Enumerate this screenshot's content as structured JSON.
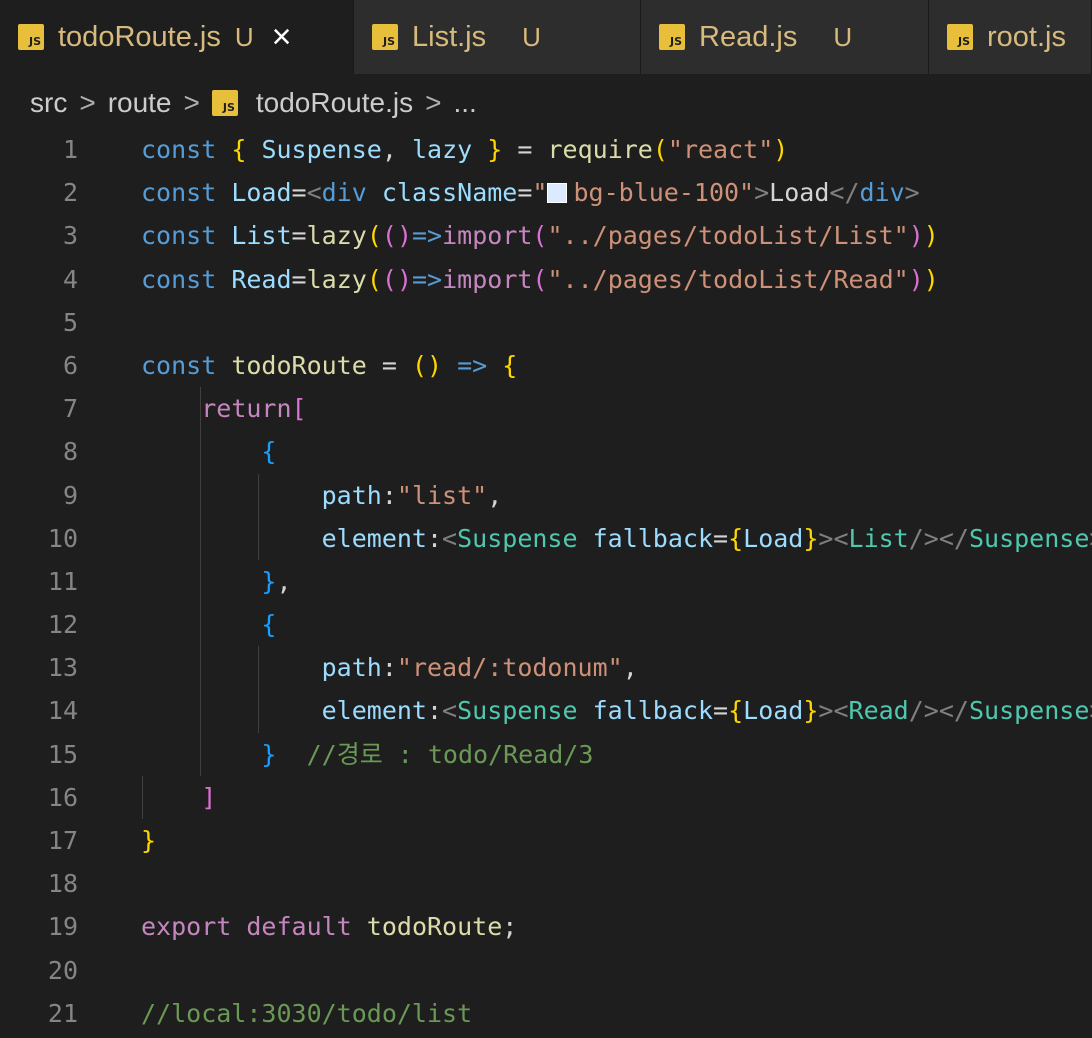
{
  "tabs": [
    {
      "label": "todoRoute.js",
      "status": "U",
      "active": true,
      "icon": "js-file-icon"
    },
    {
      "label": "List.js",
      "status": "U",
      "active": false,
      "icon": "js-file-icon"
    },
    {
      "label": "Read.js",
      "status": "U",
      "active": false,
      "icon": "js-file-icon"
    },
    {
      "label": "root.js",
      "status": "",
      "active": false,
      "icon": "js-file-icon"
    }
  ],
  "tab_icon_text": "JS",
  "tab_close_glyph": "×",
  "breadcrumb": {
    "items": [
      "src",
      "route",
      "todoRoute.js",
      "..."
    ],
    "separator": ">"
  },
  "editor": {
    "line_numbers": [
      "1",
      "2",
      "3",
      "4",
      "5",
      "6",
      "7",
      "8",
      "9",
      "10",
      "11",
      "12",
      "13",
      "14",
      "15",
      "16",
      "17",
      "18",
      "19",
      "20",
      "21"
    ],
    "lines": [
      [
        {
          "c": "kw",
          "t": "const"
        },
        {
          "c": "txt",
          "t": " "
        },
        {
          "c": "br1",
          "t": "{"
        },
        {
          "c": "txt",
          "t": " "
        },
        {
          "c": "var",
          "t": "Suspense"
        },
        {
          "c": "txt",
          "t": ", "
        },
        {
          "c": "var",
          "t": "lazy"
        },
        {
          "c": "txt",
          "t": " "
        },
        {
          "c": "br1",
          "t": "}"
        },
        {
          "c": "txt",
          "t": " = "
        },
        {
          "c": "fn",
          "t": "require"
        },
        {
          "c": "br1",
          "t": "("
        },
        {
          "c": "str",
          "t": "\"react\""
        },
        {
          "c": "br1",
          "t": ")"
        }
      ],
      [
        {
          "c": "kw",
          "t": "const"
        },
        {
          "c": "txt",
          "t": " "
        },
        {
          "c": "var",
          "t": "Load"
        },
        {
          "c": "txt",
          "t": "="
        },
        {
          "c": "punct",
          "t": "<"
        },
        {
          "c": "html-tag",
          "t": "div"
        },
        {
          "c": "txt",
          "t": " "
        },
        {
          "c": "var",
          "t": "className"
        },
        {
          "c": "txt",
          "t": "="
        },
        {
          "c": "str",
          "t": "\""
        },
        {
          "c": "swatch",
          "t": ""
        },
        {
          "c": "str",
          "t": "bg-blue-100\""
        },
        {
          "c": "punct",
          "t": ">"
        },
        {
          "c": "txt",
          "t": "Load"
        },
        {
          "c": "punct",
          "t": "</"
        },
        {
          "c": "html-tag",
          "t": "div"
        },
        {
          "c": "punct",
          "t": ">"
        }
      ],
      [
        {
          "c": "kw",
          "t": "const"
        },
        {
          "c": "txt",
          "t": " "
        },
        {
          "c": "var",
          "t": "List"
        },
        {
          "c": "txt",
          "t": "="
        },
        {
          "c": "fn",
          "t": "lazy"
        },
        {
          "c": "br1",
          "t": "("
        },
        {
          "c": "br2",
          "t": "()"
        },
        {
          "c": "kw",
          "t": "=>"
        },
        {
          "c": "kw2",
          "t": "import"
        },
        {
          "c": "br2",
          "t": "("
        },
        {
          "c": "str",
          "t": "\"../pages/todoList/List\""
        },
        {
          "c": "br2",
          "t": ")"
        },
        {
          "c": "br1",
          "t": ")"
        }
      ],
      [
        {
          "c": "kw",
          "t": "const"
        },
        {
          "c": "txt",
          "t": " "
        },
        {
          "c": "var",
          "t": "Read"
        },
        {
          "c": "txt",
          "t": "="
        },
        {
          "c": "fn",
          "t": "lazy"
        },
        {
          "c": "br1",
          "t": "("
        },
        {
          "c": "br2",
          "t": "()"
        },
        {
          "c": "kw",
          "t": "=>"
        },
        {
          "c": "kw2",
          "t": "import"
        },
        {
          "c": "br2",
          "t": "("
        },
        {
          "c": "str",
          "t": "\"../pages/todoList/Read\""
        },
        {
          "c": "br2",
          "t": ")"
        },
        {
          "c": "br1",
          "t": ")"
        }
      ],
      [],
      [
        {
          "c": "kw",
          "t": "const"
        },
        {
          "c": "txt",
          "t": " "
        },
        {
          "c": "fn",
          "t": "todoRoute"
        },
        {
          "c": "txt",
          "t": " = "
        },
        {
          "c": "br1",
          "t": "()"
        },
        {
          "c": "txt",
          "t": " "
        },
        {
          "c": "kw",
          "t": "=>"
        },
        {
          "c": "txt",
          "t": " "
        },
        {
          "c": "br1",
          "t": "{"
        }
      ],
      [
        {
          "c": "txt",
          "t": "    "
        },
        {
          "c": "kw2",
          "t": "return"
        },
        {
          "c": "br2",
          "t": "["
        }
      ],
      [
        {
          "c": "txt",
          "t": "        "
        },
        {
          "c": "br3",
          "t": "{"
        }
      ],
      [
        {
          "c": "txt",
          "t": "            "
        },
        {
          "c": "var",
          "t": "path"
        },
        {
          "c": "txt",
          "t": ":"
        },
        {
          "c": "str",
          "t": "\"list\""
        },
        {
          "c": "txt",
          "t": ","
        }
      ],
      [
        {
          "c": "txt",
          "t": "            "
        },
        {
          "c": "var",
          "t": "element"
        },
        {
          "c": "txt",
          "t": ":"
        },
        {
          "c": "punct",
          "t": "<"
        },
        {
          "c": "tag",
          "t": "Suspense"
        },
        {
          "c": "txt",
          "t": " "
        },
        {
          "c": "var",
          "t": "fallback"
        },
        {
          "c": "txt",
          "t": "="
        },
        {
          "c": "br1",
          "t": "{"
        },
        {
          "c": "var",
          "t": "Load"
        },
        {
          "c": "br1",
          "t": "}"
        },
        {
          "c": "punct",
          "t": "><"
        },
        {
          "c": "tag",
          "t": "List"
        },
        {
          "c": "punct",
          "t": "/></"
        },
        {
          "c": "tag",
          "t": "Suspense"
        },
        {
          "c": "punct",
          "t": ">"
        }
      ],
      [
        {
          "c": "txt",
          "t": "        "
        },
        {
          "c": "br3",
          "t": "}"
        },
        {
          "c": "txt",
          "t": ","
        }
      ],
      [
        {
          "c": "txt",
          "t": "        "
        },
        {
          "c": "br3",
          "t": "{"
        }
      ],
      [
        {
          "c": "txt",
          "t": "            "
        },
        {
          "c": "var",
          "t": "path"
        },
        {
          "c": "txt",
          "t": ":"
        },
        {
          "c": "str",
          "t": "\"read/:todonum\""
        },
        {
          "c": "txt",
          "t": ","
        }
      ],
      [
        {
          "c": "txt",
          "t": "            "
        },
        {
          "c": "var",
          "t": "element"
        },
        {
          "c": "txt",
          "t": ":"
        },
        {
          "c": "punct",
          "t": "<"
        },
        {
          "c": "tag",
          "t": "Suspense"
        },
        {
          "c": "txt",
          "t": " "
        },
        {
          "c": "var",
          "t": "fallback"
        },
        {
          "c": "txt",
          "t": "="
        },
        {
          "c": "br1",
          "t": "{"
        },
        {
          "c": "var",
          "t": "Load"
        },
        {
          "c": "br1",
          "t": "}"
        },
        {
          "c": "punct",
          "t": "><"
        },
        {
          "c": "tag",
          "t": "Read"
        },
        {
          "c": "punct",
          "t": "/></"
        },
        {
          "c": "tag",
          "t": "Suspense"
        },
        {
          "c": "punct",
          "t": ">"
        }
      ],
      [
        {
          "c": "txt",
          "t": "        "
        },
        {
          "c": "br3",
          "t": "}"
        },
        {
          "c": "txt",
          "t": "  "
        },
        {
          "c": "cm",
          "t": "//경로 : todo/Read/3"
        }
      ],
      [
        {
          "c": "txt",
          "t": "    "
        },
        {
          "c": "br2",
          "t": "]"
        }
      ],
      [
        {
          "c": "br1",
          "t": "}"
        }
      ],
      [],
      [
        {
          "c": "kw2",
          "t": "export"
        },
        {
          "c": "txt",
          "t": " "
        },
        {
          "c": "kw2",
          "t": "default"
        },
        {
          "c": "txt",
          "t": " "
        },
        {
          "c": "fn",
          "t": "todoRoute"
        },
        {
          "c": "txt",
          "t": ";"
        }
      ],
      [],
      [
        {
          "c": "cm",
          "t": "//local:3030/todo/list"
        }
      ]
    ]
  },
  "colors": {
    "background": "#1e1e1e",
    "tab_label": "#d7ba7d",
    "js_icon": "#e8bf3a"
  }
}
